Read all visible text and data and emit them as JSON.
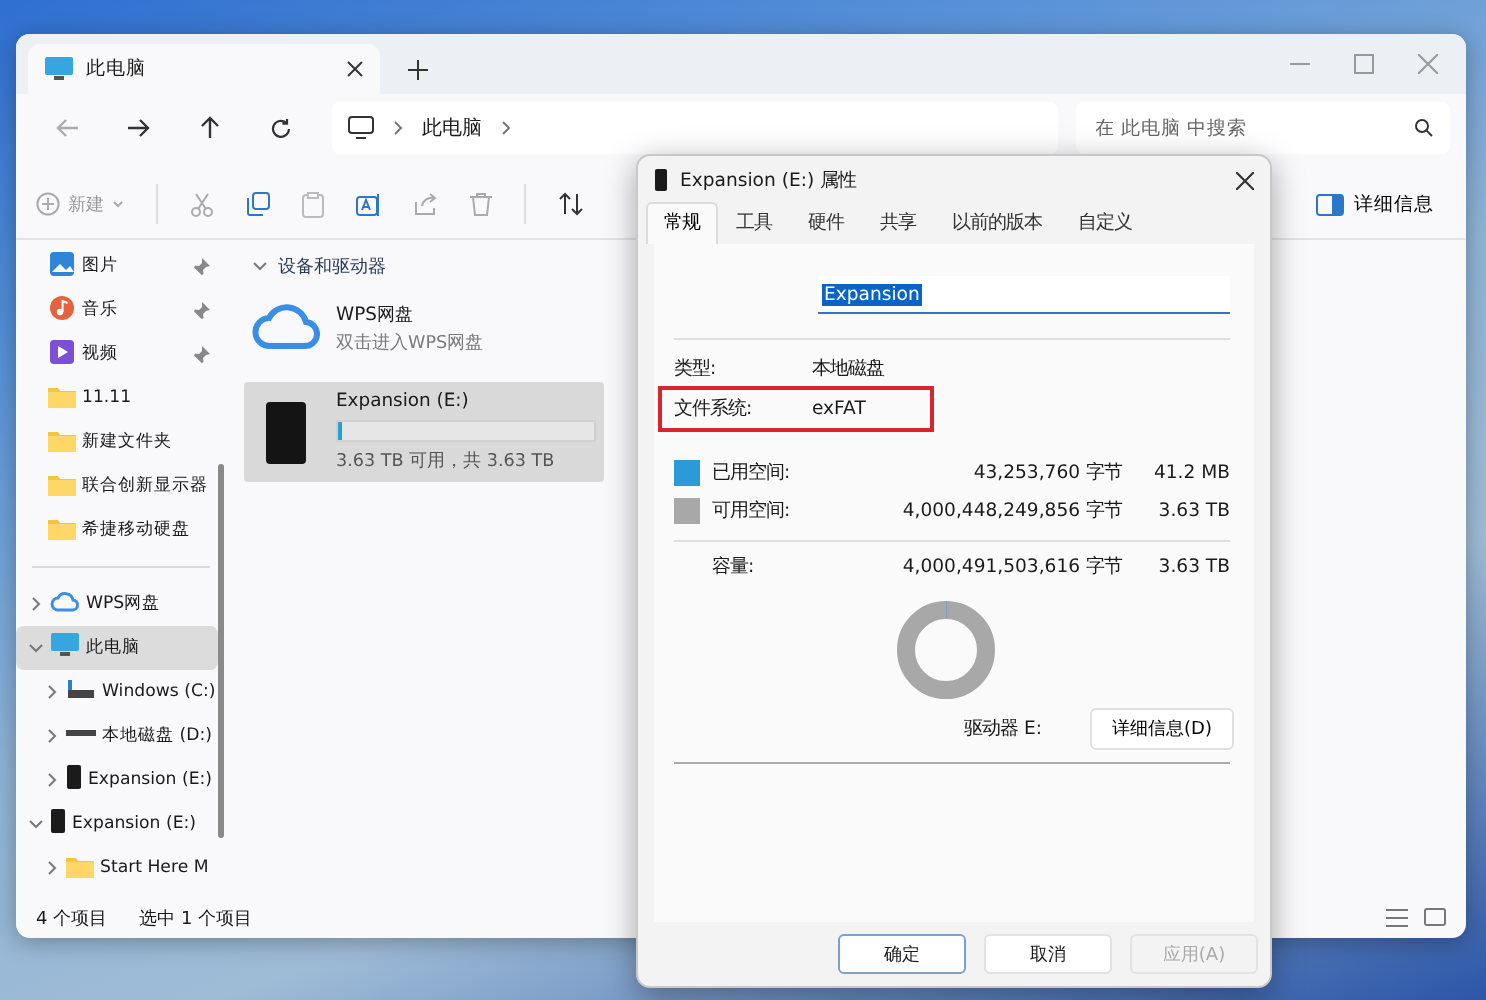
{
  "explorer": {
    "tab_title": "此电脑",
    "address": [
      "此电脑"
    ],
    "search": {
      "placeholder": "在 此电脑 中搜索"
    },
    "toolbar": {
      "new_label": "新建",
      "details_label": "详细信息"
    },
    "nav_quick": [
      {
        "label": "图片",
        "kind": "pictures",
        "pinned": true
      },
      {
        "label": "音乐",
        "kind": "music",
        "pinned": true
      },
      {
        "label": "视频",
        "kind": "video",
        "pinned": true
      },
      {
        "label": "11.11",
        "kind": "folder",
        "pinned": false
      },
      {
        "label": "新建文件夹",
        "kind": "folder",
        "pinned": false
      },
      {
        "label": "联合创新显示器",
        "kind": "folder",
        "pinned": false
      },
      {
        "label": "希捷移动硬盘",
        "kind": "folder",
        "pinned": false
      }
    ],
    "nav_tree": [
      {
        "label": "WPS网盘",
        "kind": "cloud",
        "expanded": false,
        "selected": false
      },
      {
        "label": "此电脑",
        "kind": "pc",
        "expanded": true,
        "selected": true,
        "children": [
          {
            "label": "Windows (C:)",
            "kind": "system_drive",
            "expanded": false,
            "selected": false
          },
          {
            "label": "本地磁盘 (D:)",
            "kind": "drive",
            "expanded": false,
            "selected": false
          },
          {
            "label": "Expansion (E:)",
            "kind": "external",
            "expanded": false,
            "selected": false
          }
        ]
      },
      {
        "label": "Expansion (E:)",
        "kind": "external",
        "expanded": true,
        "selected": false,
        "children": [
          {
            "label": "Start Here M",
            "kind": "folder",
            "expanded": false,
            "selected": false
          }
        ]
      }
    ],
    "section": {
      "title": "设备和驱动器",
      "expanded": true
    },
    "items": [
      {
        "kind": "cloud",
        "name": "WPS网盘",
        "subtitle": "双击进入WPS网盘",
        "selected": false
      },
      {
        "kind": "drive",
        "name": "Expansion (E:)",
        "level": 0,
        "subtitle": "3.63 TB 可用，共 3.63 TB",
        "selected": true
      }
    ],
    "status": [
      "4 个项目",
      "选中 1 个项目"
    ]
  },
  "dialog": {
    "title": "Expansion (E:) 属性",
    "tabs": [
      {
        "label": "常规",
        "selected": true
      },
      {
        "label": "工具",
        "selected": false
      },
      {
        "label": "硬件",
        "selected": false
      },
      {
        "label": "共享",
        "selected": false
      },
      {
        "label": "以前的版本",
        "selected": false
      },
      {
        "label": "自定义",
        "selected": false
      }
    ],
    "name_value": "Expansion",
    "info": [
      {
        "label": "类型:",
        "value": "本地磁盘",
        "highlighted": false
      },
      {
        "label": "文件系统:",
        "value": "exFAT",
        "highlighted": true
      }
    ],
    "space": [
      {
        "label": "已用空间:",
        "bytes": "43,253,760 字节",
        "size": "41.2 MB",
        "color": "#2b9ad9"
      },
      {
        "label": "可用空间:",
        "bytes": "4,000,448,249,856 字节",
        "size": "3.63 TB",
        "color": "#a8a8a8"
      }
    ],
    "capacity": {
      "label": "容量:",
      "bytes": "4,000,491,503,616 字节",
      "size": "3.63 TB"
    },
    "drive_label": "驱动器 E:",
    "details_button": "详细信息(D)",
    "buttons": [
      {
        "label": "确定",
        "kind": "default",
        "disabled": false
      },
      {
        "label": "取消",
        "kind": "normal",
        "disabled": false
      },
      {
        "label": "应用(A)",
        "kind": "normal",
        "disabled": true
      }
    ]
  }
}
